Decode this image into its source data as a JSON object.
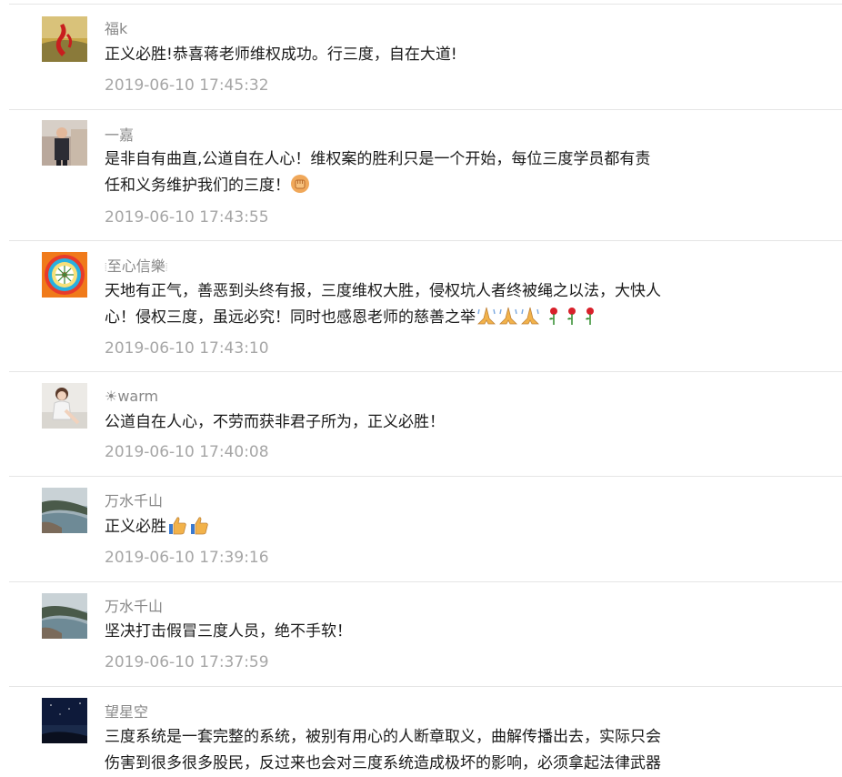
{
  "comments": [
    {
      "nickname": "福k",
      "text": "正义必胜!恭喜蒋老师维权成功。行三度，自在大道!",
      "time": "2019-06-10 17:45:32",
      "avatar_icon": "red-sculpture-avatar"
    },
    {
      "nickname": "一嘉",
      "text_line1": "是非自有曲直,公道自在人心！维权案的胜利只是一个开始，每位三度学员都有责",
      "text_line2": "任和义务维护我们的三度！",
      "emoji": "fist-emoji",
      "time": "2019-06-10 17:43:55",
      "avatar_icon": "man-standing-avatar"
    },
    {
      "nickname": "至心信樂",
      "text_line1": "天地有正气，善恶到头终有报，三度维权大胜，侵权坑人者终被绳之以法，大快人",
      "text_line2": "心！侵权三度，虽远必究！同时也感恩老师的慈善之举",
      "emoji": [
        "praying-hands-emoji",
        "praying-hands-emoji",
        "praying-hands-emoji",
        "rose-emoji",
        "rose-emoji",
        "rose-emoji"
      ],
      "time": "2019-06-10 17:43:10",
      "avatar_icon": "mandala-avatar"
    },
    {
      "nickname": "☀warm",
      "text": "公道自在人心，不劳而获非君子所为，正义必胜！",
      "time": "2019-06-10 17:40:08",
      "avatar_icon": "woman-photo-avatar"
    },
    {
      "nickname": "万水千山",
      "text": "正义必胜",
      "emoji": [
        "thumbs-up-emoji",
        "thumbs-up-emoji"
      ],
      "time": "2019-06-10 17:39:16",
      "avatar_icon": "coastline-avatar"
    },
    {
      "nickname": "万水千山",
      "text": "坚决打击假冒三度人员，绝不手软！",
      "time": "2019-06-10 17:37:59",
      "avatar_icon": "coastline-avatar"
    },
    {
      "nickname": "望星空",
      "text_line1": "三度系统是一套完整的系统，被别有用心的人断章取义，曲解传播出去，实际只会",
      "text_line2": "伤害到很多很多股民，反过来也会对三度系统造成极坏的影响，必须拿起法律武器",
      "avatar_icon": "night-sky-avatar"
    }
  ],
  "colors": {
    "nickname": "#888888",
    "text": "#1a1a1a",
    "time": "#a6a6a6",
    "divider": "#e5e5e5"
  }
}
